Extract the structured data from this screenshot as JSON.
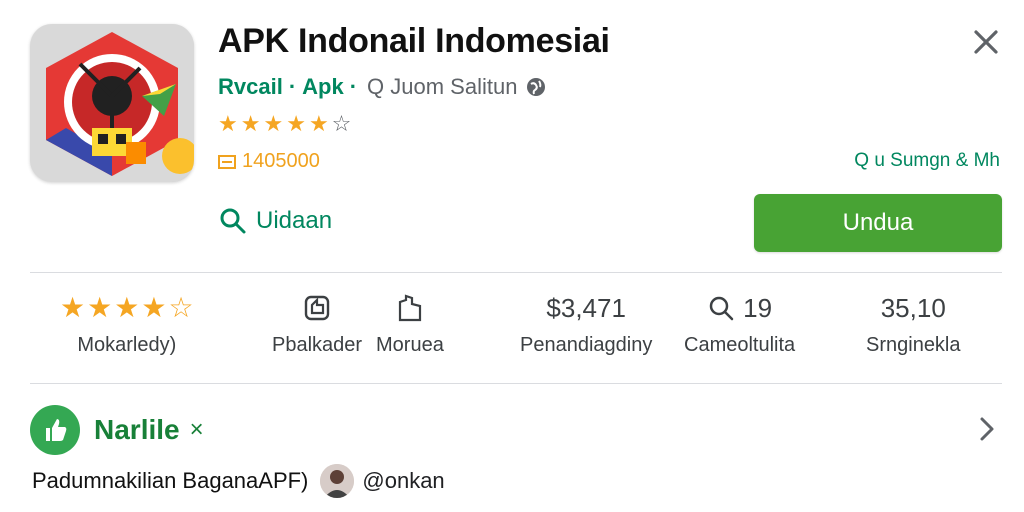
{
  "app": {
    "title": "APK Indonail Indomesiai",
    "developer": "Rvcail",
    "category": "Apk",
    "subtitle": "Q Juom Salitun",
    "rating_stars": 4,
    "downloads": "1405000",
    "contains": "Q u Sumgn & Mh",
    "wishlist_label": "Uidaan",
    "install_label": "Undua"
  },
  "stats": [
    {
      "value": "",
      "label": "Mokarledy)",
      "type": "stars"
    },
    {
      "value": "",
      "label": "Pbalkader",
      "type": "icon",
      "icon": "thumbs-up-icon"
    },
    {
      "value": "",
      "label": "Moruea",
      "type": "icon",
      "icon": "hand-icon"
    },
    {
      "value": "$3,471",
      "label": "Penandiagdiny",
      "type": "text"
    },
    {
      "value": "19",
      "label": "Cameoltulita",
      "type": "search"
    },
    {
      "value": "35,10",
      "label": "Srnginekla",
      "type": "text"
    }
  ],
  "section": {
    "title": "Narlile",
    "badge": "×"
  },
  "footer": {
    "text": "Padumnakilian BaganaAPF)",
    "handle": "@onkan"
  },
  "colors": {
    "accent_green": "#01875f",
    "install_green": "#48a334",
    "star_gold": "#f5a623"
  }
}
